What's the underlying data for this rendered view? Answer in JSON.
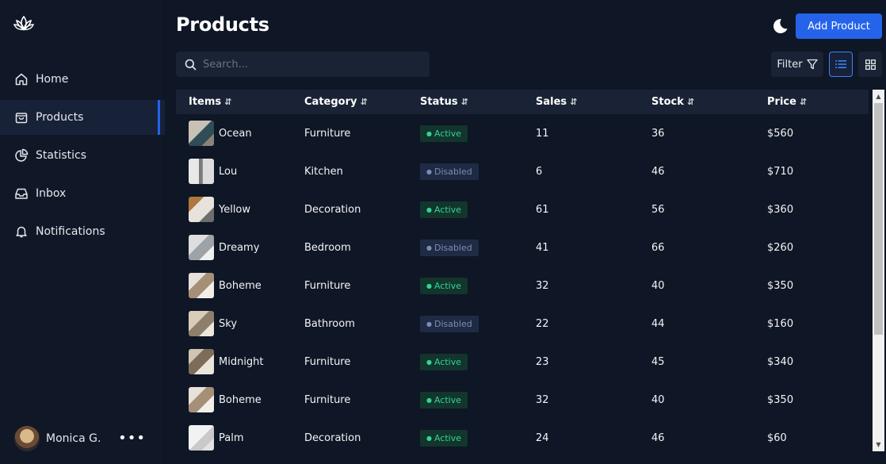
{
  "sidebar": {
    "items": [
      {
        "label": "Home",
        "icon": "home-icon"
      },
      {
        "label": "Products",
        "icon": "shopping-bag-icon",
        "active": true
      },
      {
        "label": "Statistics",
        "icon": "pie-chart-icon"
      },
      {
        "label": "Inbox",
        "icon": "inbox-icon"
      },
      {
        "label": "Notifications",
        "icon": "bell-icon"
      }
    ],
    "user": {
      "name": "Monica G.",
      "more": "•••"
    }
  },
  "header": {
    "title": "Products",
    "add_label": "Add Product"
  },
  "toolbar": {
    "search_placeholder": "Search...",
    "filter_label": "Filter"
  },
  "table": {
    "columns": [
      {
        "label": "Items",
        "sort": "⇵"
      },
      {
        "label": "Category",
        "sort": "⇵"
      },
      {
        "label": "Status",
        "sort": "⇵"
      },
      {
        "label": "Sales",
        "sort": "⇵"
      },
      {
        "label": "Stock",
        "sort": "⇵"
      },
      {
        "label": "Price",
        "sort": "⇵"
      }
    ],
    "rows": [
      {
        "item": "Ocean",
        "category": "Furniture",
        "status": "Active",
        "sales": "11",
        "stock": "36",
        "price": "$560"
      },
      {
        "item": "Lou",
        "category": "Kitchen",
        "status": "Disabled",
        "sales": "6",
        "stock": "46",
        "price": "$710"
      },
      {
        "item": "Yellow",
        "category": "Decoration",
        "status": "Active",
        "sales": "61",
        "stock": "56",
        "price": "$360"
      },
      {
        "item": "Dreamy",
        "category": "Bedroom",
        "status": "Disabled",
        "sales": "41",
        "stock": "66",
        "price": "$260"
      },
      {
        "item": "Boheme",
        "category": "Furniture",
        "status": "Active",
        "sales": "32",
        "stock": "40",
        "price": "$350"
      },
      {
        "item": "Sky",
        "category": "Bathroom",
        "status": "Disabled",
        "sales": "22",
        "stock": "44",
        "price": "$160"
      },
      {
        "item": "Midnight",
        "category": "Furniture",
        "status": "Active",
        "sales": "23",
        "stock": "45",
        "price": "$340"
      },
      {
        "item": "Boheme",
        "category": "Furniture",
        "status": "Active",
        "sales": "32",
        "stock": "40",
        "price": "$350"
      },
      {
        "item": "Palm",
        "category": "Decoration",
        "status": "Active",
        "sales": "24",
        "stock": "46",
        "price": "$60"
      }
    ]
  },
  "colors": {
    "accent": "#2563eb",
    "active_text": "#34d399",
    "disabled_text": "#7c8db5"
  }
}
